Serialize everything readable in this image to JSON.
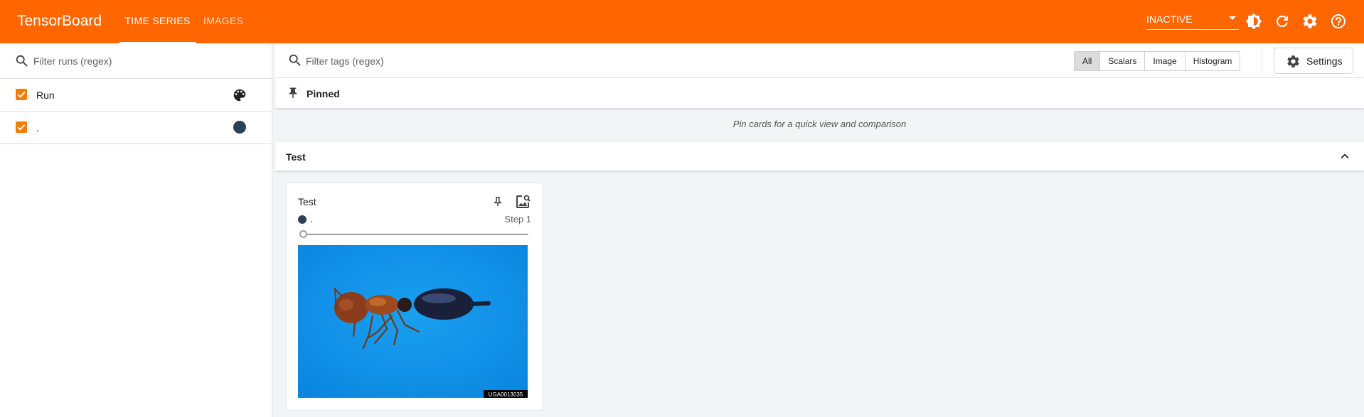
{
  "header": {
    "brand": "TensorBoard",
    "tabs": [
      {
        "label": "TIME SERIES",
        "active": true
      },
      {
        "label": "IMAGES",
        "active": false
      }
    ],
    "reload_status": "INACTIVE",
    "icons": [
      "dark-mode-icon",
      "refresh-icon",
      "settings-icon",
      "help-icon"
    ]
  },
  "runs": {
    "filter_placeholder": "Filter runs (regex)",
    "items": [
      {
        "label": "Run",
        "checked": true,
        "trailing": "palette-icon"
      },
      {
        "label": ".",
        "checked": true,
        "color": "#2e4053"
      }
    ]
  },
  "main": {
    "filter_placeholder": "Filter tags (regex)",
    "type_filters": [
      "All",
      "Scalars",
      "Image",
      "Histogram"
    ],
    "selected_type": "All",
    "settings_label": "Settings",
    "pinned": {
      "label": "Pinned",
      "empty_hint": "Pin cards for a quick view and comparison"
    },
    "group": {
      "label": "Test",
      "expanded": true
    },
    "card": {
      "title": "Test",
      "run_label": ".",
      "step_label": "Step 1",
      "step_slider": 0,
      "image_alt": "ant on blue background",
      "image_stamp": "UGA0013035"
    }
  },
  "colors": {
    "header": "#ff6600",
    "checkbox": "#f57c00",
    "run_color": "#2e4053",
    "image_background": "#0a8ee8"
  }
}
